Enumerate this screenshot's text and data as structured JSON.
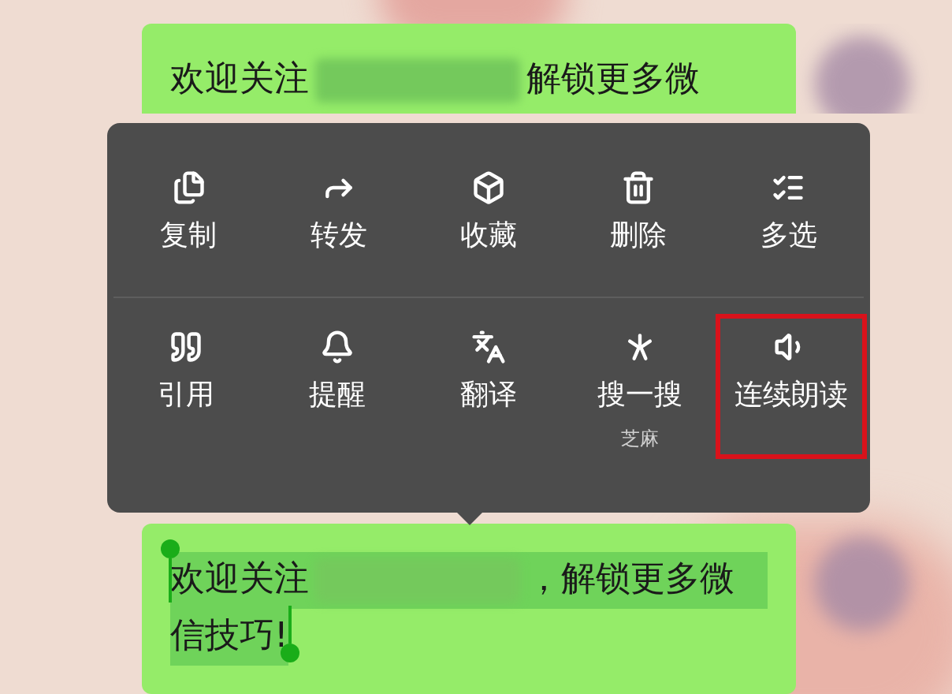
{
  "messages": [
    {
      "text_before": "欢迎关注",
      "text_after": "解锁更多微",
      "selected": false
    },
    {
      "text_before": "欢迎关注",
      "text_after": "，解锁更多微",
      "line_2": "信技巧!",
      "selected": true
    }
  ],
  "menu": {
    "rows": [
      [
        {
          "label": "复制",
          "highlighted": false
        },
        {
          "label": "转发",
          "highlighted": false
        },
        {
          "label": "收藏",
          "highlighted": false
        },
        {
          "label": "删除",
          "highlighted": false
        },
        {
          "label": "多选",
          "highlighted": false
        }
      ],
      [
        {
          "label": "引用",
          "highlighted": false
        },
        {
          "label": "提醒",
          "highlighted": false
        },
        {
          "label": "翻译",
          "highlighted": false
        },
        {
          "label": "搜一搜",
          "sublabel": "芝麻",
          "highlighted": false
        },
        {
          "label": "连续朗读",
          "highlighted": true
        }
      ]
    ]
  }
}
